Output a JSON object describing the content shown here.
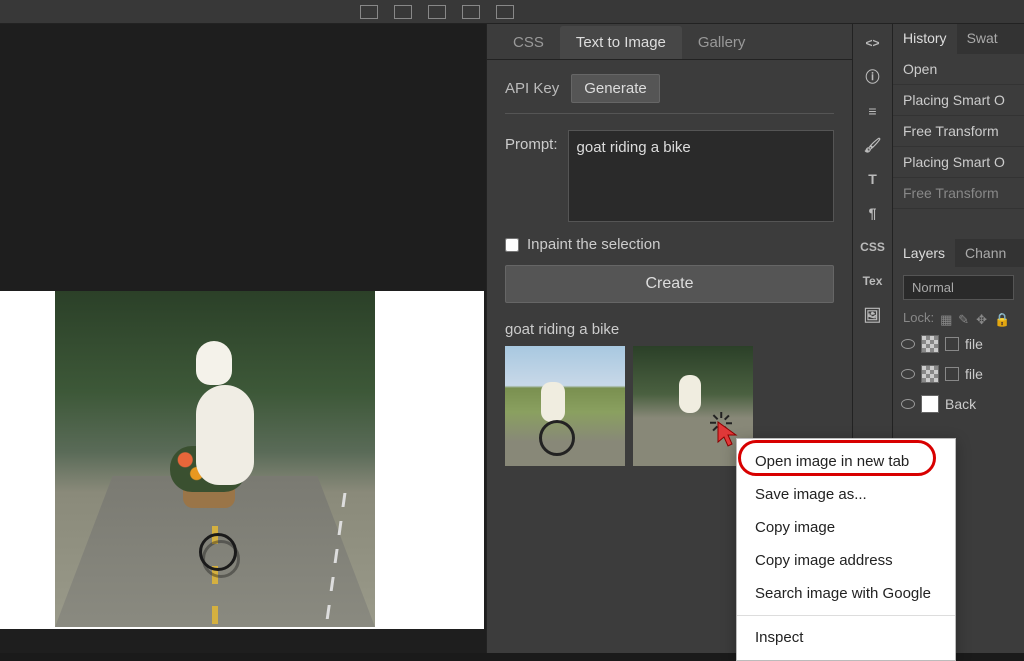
{
  "panel": {
    "tabs": [
      "CSS",
      "Text to Image",
      "Gallery"
    ],
    "active_tab": "Text to Image",
    "api_key_label": "API Key",
    "generate_label": "Generate",
    "prompt_label": "Prompt:",
    "prompt_value": "goat riding a bike",
    "inpaint_label": "Inpaint the selection",
    "inpaint_checked": false,
    "create_label": "Create",
    "results_label": "goat riding a bike"
  },
  "sidebar_icons": [
    "<>",
    "ⓘ",
    "≡",
    "🖌",
    "T",
    "¶",
    "CSS",
    "Tex",
    "🖼"
  ],
  "right_panel": {
    "history_tab": "History",
    "swatches_tab": "Swat",
    "history_items": [
      {
        "label": "Open",
        "dim": false
      },
      {
        "label": "Placing Smart O",
        "dim": false
      },
      {
        "label": "Free Transform",
        "dim": false
      },
      {
        "label": "Placing Smart O",
        "dim": false
      },
      {
        "label": "Free Transform",
        "dim": true
      }
    ],
    "layers_tab": "Layers",
    "channels_tab": "Chann",
    "blend_mode": "Normal",
    "lock_label": "Lock:",
    "layers": [
      {
        "name": "file"
      },
      {
        "name": "file"
      },
      {
        "name": "Back"
      }
    ]
  },
  "context_menu": {
    "items": [
      "Open image in new tab",
      "Save image as...",
      "Copy image",
      "Copy image address",
      "Search image with Google"
    ],
    "inspect": "Inspect",
    "highlighted": "Open image in new tab"
  }
}
